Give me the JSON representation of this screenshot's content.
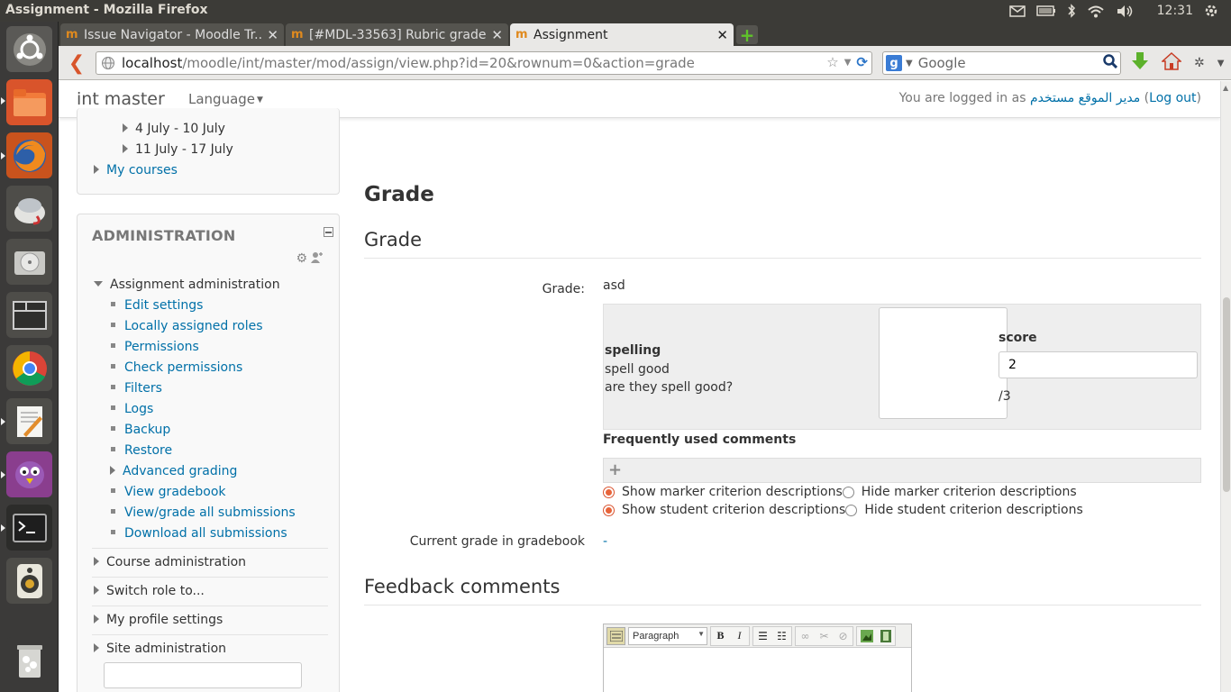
{
  "system": {
    "window_title": "Assignment - Mozilla Firefox",
    "clock": "12:31"
  },
  "launcher": {
    "items": [
      "dash-icon",
      "files-icon",
      "firefox-icon",
      "mail-icon",
      "disk-icon",
      "workspace-icon",
      "chrome-icon",
      "text-editor-icon",
      "pidgin-icon",
      "terminal-icon",
      "speaker-icon",
      "trash-icon"
    ]
  },
  "browser": {
    "tabs": [
      {
        "label": "Issue Navigator - Moodle Tr...",
        "favicon": "m"
      },
      {
        "label": "[#MDL-33563] Rubric grade...",
        "favicon": "m"
      },
      {
        "label": "Assignment",
        "favicon": "m"
      }
    ],
    "url_host": "localhost",
    "url_path": "/moodle/int/master/mod/assign/view.php?id=20&rownum=0&action=grade",
    "search_placeholder": "Google"
  },
  "header": {
    "site_name": "int master",
    "language": "Language",
    "login_prefix": "You are logged in as ",
    "user_name": "مدير الموقع مستخدم",
    "logout": "Log out"
  },
  "nav_block": {
    "items": [
      {
        "label": "4 July - 10 July"
      },
      {
        "label": "11 July - 17 July"
      },
      {
        "label": "My courses"
      }
    ]
  },
  "admin_block": {
    "title": "ADMINISTRATION",
    "assignment_admin": "Assignment administration",
    "links": [
      "Edit settings",
      "Locally assigned roles",
      "Permissions",
      "Check permissions",
      "Filters",
      "Logs",
      "Backup",
      "Restore",
      "Advanced grading",
      "View gradebook",
      "View/grade all submissions",
      "Download all submissions"
    ],
    "sections": [
      "Course administration",
      "Switch role to...",
      "My profile settings",
      "Site administration"
    ]
  },
  "main": {
    "heading": "Grade",
    "section_grade": "Grade",
    "grade_label": "Grade:",
    "grade_value": "asd",
    "rubric": {
      "criterion_name": "spelling",
      "level_definition": "spell good",
      "level_question": "are they spell good?",
      "score_label": "score",
      "score_value": "2",
      "out_of": "/3"
    },
    "fuc_title": "Frequently used comments",
    "radios": {
      "show_marker": "Show marker criterion descriptions",
      "hide_marker": "Hide marker criterion descriptions",
      "show_student": "Show student criterion descriptions",
      "hide_student": "Hide student criterion descriptions"
    },
    "current_grade_label": "Current grade in gradebook",
    "current_grade_value": "-",
    "feedback_heading": "Feedback comments",
    "editor_format": "Paragraph"
  }
}
